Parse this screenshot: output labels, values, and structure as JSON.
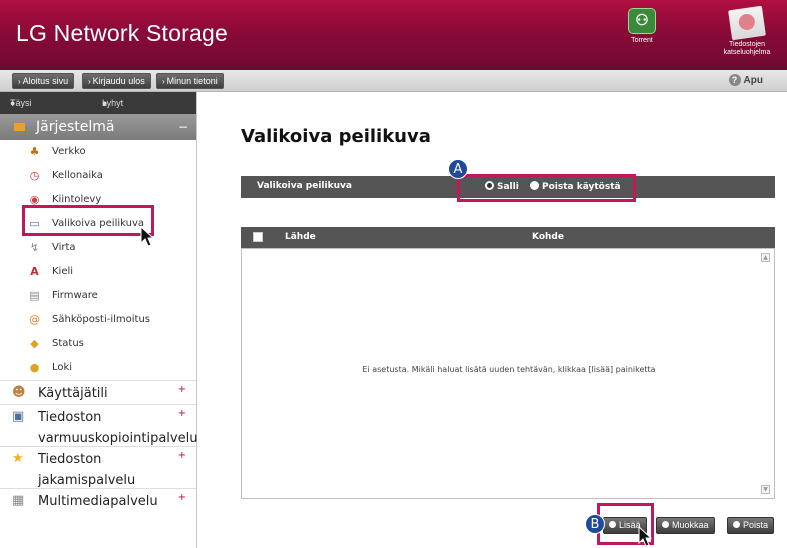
{
  "header": {
    "brand": "LG Network Storage",
    "torrent_label": "Torrent",
    "viewer_label_1": "Tiedostojen",
    "viewer_label_2": "katseluohjelma"
  },
  "toolbar": {
    "home": "Aloitus sivu",
    "logout": "Kirjaudu ulos",
    "myinfo": "Minun tietoni",
    "help": "Apu"
  },
  "sidebar": {
    "full_menu": "Täysi valikko",
    "short_menu": "Lyhyt valikko",
    "system": "Järjestelmä",
    "sub_items": [
      {
        "label": "Verkko",
        "icon": "network-icon"
      },
      {
        "label": "Kellonaika",
        "icon": "clock-icon"
      },
      {
        "label": "Kiintolevy",
        "icon": "disk-icon"
      },
      {
        "label": "Valikoiva peilikuva",
        "icon": "mirror-icon"
      },
      {
        "label": "Virta",
        "icon": "power-icon"
      },
      {
        "label": "Kieli",
        "icon": "language-icon"
      },
      {
        "label": "Firmware",
        "icon": "firmware-icon"
      },
      {
        "label": "Sähköposti-ilmoitus",
        "icon": "email-icon"
      },
      {
        "label": "Status",
        "icon": "status-icon"
      },
      {
        "label": "Loki",
        "icon": "log-icon"
      }
    ],
    "major_items": [
      {
        "label": "Käyttäjätili",
        "icon": "user-icon"
      },
      {
        "label_1": "Tiedoston",
        "label_2": "varmuuskopiointipalvelu",
        "icon": "backup-icon"
      },
      {
        "label_1": "Tiedoston",
        "label_2": "jakamispalvelu",
        "icon": "star-icon"
      },
      {
        "label": "Multimediapalvelu",
        "icon": "multimedia-icon"
      }
    ]
  },
  "main": {
    "title": "Valikoiva peilikuva",
    "setting_label": "Valikoiva peilikuva",
    "allow": "Salli",
    "disable": "Poista käytöstä",
    "col_source": "Lähde",
    "col_target": "Kohde",
    "empty_message": "Ei asetusta. Mikäli haluat lisätä uuden tehtävän, klikkaa [lisää] painiketta",
    "btn_add": "Lisää",
    "btn_edit": "Muokkaa",
    "btn_delete": "Poista"
  },
  "annotations": {
    "a": "A",
    "b": "B",
    "highlight_color": "#c0185a",
    "badge_color": "#1f4a9a"
  }
}
